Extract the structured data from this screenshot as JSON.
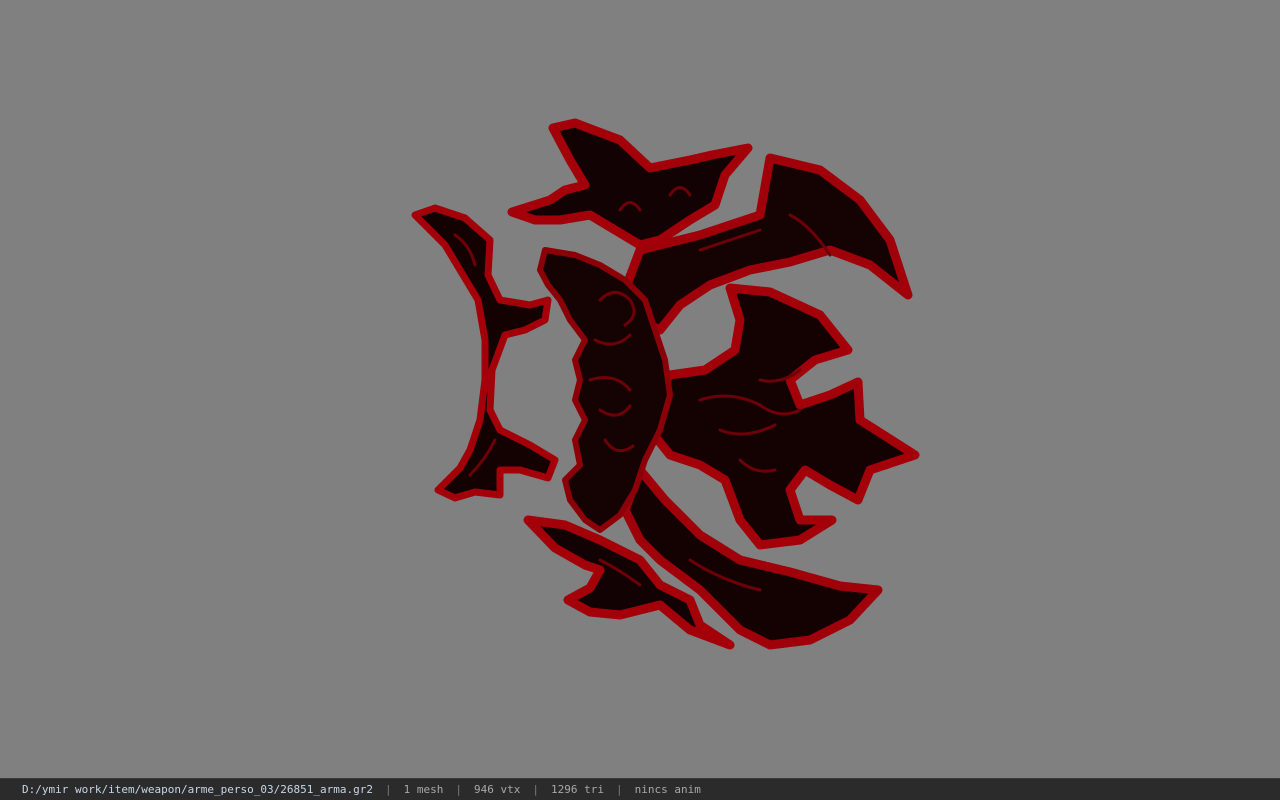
{
  "viewer": {
    "background_color": "#808080",
    "model_colors": {
      "dark": "#0b0203",
      "red": "#9a0008",
      "bright_red": "#c0000c",
      "pattern": "#6b0006"
    }
  },
  "status": {
    "file_path": "D:/ymir work/item/weapon/arme_perso_03/26851_arma.gr2",
    "separator": "|",
    "mesh": "1 mesh",
    "vertices": "946 vtx",
    "triangles": "1296 tri",
    "anim": "nincs anim"
  }
}
